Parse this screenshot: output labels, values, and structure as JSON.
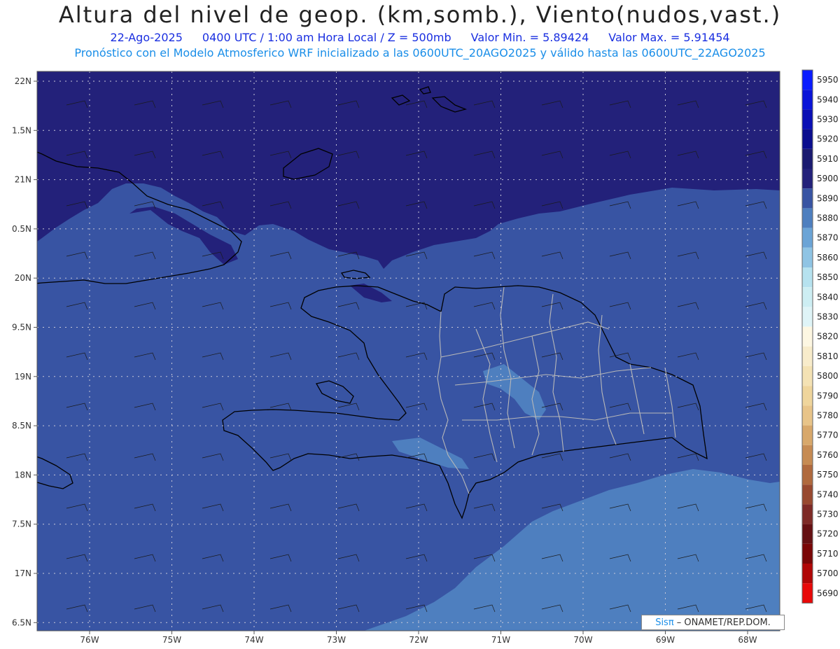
{
  "header": {
    "title": "Altura del nivel de geop. (km,somb.), Viento(nudos,vast.)",
    "date": "22-Ago-2025",
    "time": "0400 UTC / 1:00 am Hora Local / Z = 500mb",
    "min_label": "Valor Min. = 5.89424",
    "max_label": "Valor Max. = 5.91454",
    "subtitle": "Pronóstico con el Modelo Atmosferico WRF inicializado a las 0600UTC_20AGO2025 y válido hasta las  0600UTC_22AGO2025"
  },
  "map": {
    "lon_ticks": [
      "76W",
      "75W",
      "74W",
      "73W",
      "72W",
      "71W",
      "70W",
      "69W",
      "68W"
    ],
    "lat_ticks": [
      "22N",
      "1.5N",
      "21N",
      "0.5N",
      "20N",
      "9.5N",
      "19N",
      "8.5N",
      "18N",
      "7.5N",
      "17N",
      "6.5N"
    ],
    "colors": {
      "shade_5910": "#23217a",
      "shade_5900": "#3854a3",
      "shade_5890": "#4e7fbf",
      "coast": "#000000",
      "borders": "#b8b8b8",
      "grid": "#c8c8d8"
    }
  },
  "legend": {
    "levels": [
      "5950",
      "5940",
      "5930",
      "5920",
      "5910",
      "5900",
      "5890",
      "5880",
      "5870",
      "5860",
      "5850",
      "5840",
      "5830",
      "5820",
      "5810",
      "5800",
      "5790",
      "5780",
      "5770",
      "5760",
      "5750",
      "5740",
      "5730",
      "5720",
      "5710",
      "5700",
      "5690"
    ],
    "colors": [
      "#0a1cff",
      "#0a14d8",
      "#0a0fb5",
      "#0a0d8e",
      "#1a1a70",
      "#23217a",
      "#3854a3",
      "#4e7fbf",
      "#6ba4d6",
      "#8fc4e4",
      "#b6e2ef",
      "#cdeef3",
      "#dff4f7",
      "#fdf7e2",
      "#f8eccb",
      "#f4e2b4",
      "#efd59c",
      "#e8c489",
      "#d8a86b",
      "#c68b53",
      "#b06a3e",
      "#98492f",
      "#7e2a26",
      "#651012",
      "#7a0606",
      "#b00606",
      "#e80808"
    ]
  },
  "footer": {
    "credit_sis": "Sisπ",
    "credit_rest": " – ONAMET/REP.DOM."
  }
}
